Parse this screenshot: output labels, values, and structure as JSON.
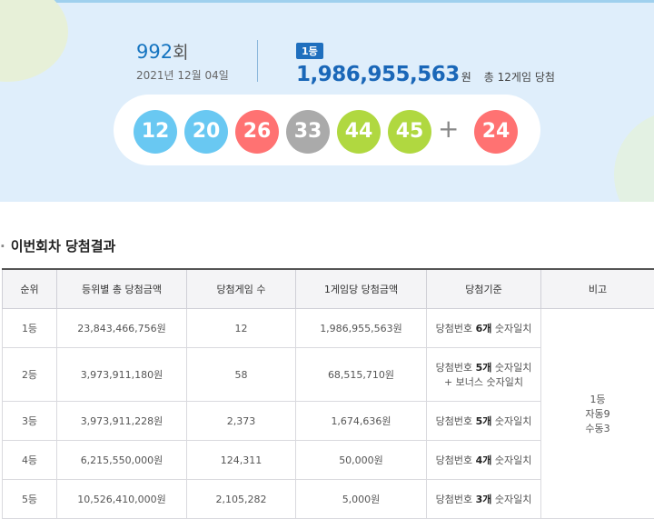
{
  "hero": {
    "round_number": "992",
    "round_suffix": "회",
    "draw_date": "2021년 12월 04일",
    "rank_badge": "1등",
    "first_prize_amount": "1,986,955,563",
    "prize_unit": "원",
    "winner_info": "총 12게임 당첨",
    "numbers": [
      {
        "value": "12",
        "color": "#69c8f2"
      },
      {
        "value": "20",
        "color": "#69c8f2"
      },
      {
        "value": "26",
        "color": "#ff7272"
      },
      {
        "value": "33",
        "color": "#aaaaaa"
      },
      {
        "value": "44",
        "color": "#b0d840"
      },
      {
        "value": "45",
        "color": "#b0d840"
      }
    ],
    "plus": "+",
    "bonus": {
      "value": "24",
      "color": "#ff7272"
    }
  },
  "results": {
    "title": "이번회차 당첨결과",
    "headers": [
      "순위",
      "등위별 총 당첨금액",
      "당첨게임 수",
      "1게임당 당첨금액",
      "당첨기준",
      "비고"
    ],
    "rows": [
      {
        "rank": "1등",
        "total": "23,843,466,756원",
        "games": "12",
        "per_game": "1,986,955,563원",
        "criteria_pre": "당첨번호 ",
        "criteria_hl": "6개",
        "criteria_post": " 숫자일치",
        "criteria_extra": ""
      },
      {
        "rank": "2등",
        "total": "3,973,911,180원",
        "games": "58",
        "per_game": "68,515,710원",
        "criteria_pre": "당첨번호 ",
        "criteria_hl": "5개",
        "criteria_post": " 숫자일치",
        "criteria_extra": "+ 보너스 숫자일치"
      },
      {
        "rank": "3등",
        "total": "3,973,911,228원",
        "games": "2,373",
        "per_game": "1,674,636원",
        "criteria_pre": "당첨번호 ",
        "criteria_hl": "5개",
        "criteria_post": " 숫자일치",
        "criteria_extra": ""
      },
      {
        "rank": "4등",
        "total": "6,215,550,000원",
        "games": "124,311",
        "per_game": "50,000원",
        "criteria_pre": "당첨번호 ",
        "criteria_hl": "4개",
        "criteria_post": " 숫자일치",
        "criteria_extra": ""
      },
      {
        "rank": "5등",
        "total": "10,526,410,000원",
        "games": "2,105,282",
        "per_game": "5,000원",
        "criteria_pre": "당첨번호 ",
        "criteria_hl": "3개",
        "criteria_post": " 숫자일치",
        "criteria_extra": ""
      }
    ],
    "note": {
      "line1": "1등",
      "line2": "자동9",
      "line3": "수동3"
    }
  }
}
